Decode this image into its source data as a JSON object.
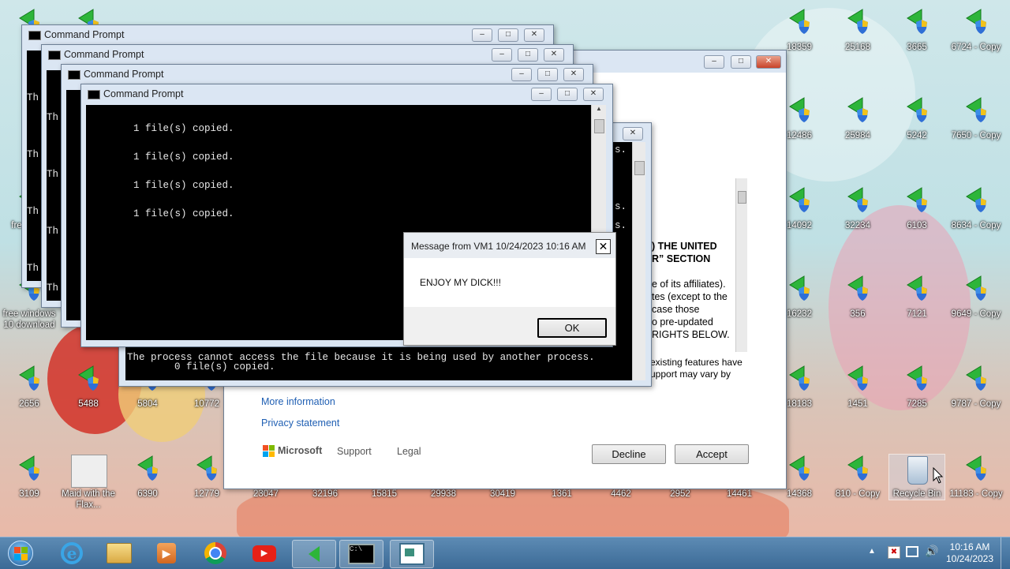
{
  "desktop_icons": [
    {
      "id": "r1c1",
      "label": "Co"
    },
    {
      "id": "r1c2",
      "label": ""
    },
    {
      "id": "r1c11",
      "label": "18359"
    },
    {
      "id": "r1c12",
      "label": "25168"
    },
    {
      "id": "r1c13",
      "label": "3665"
    },
    {
      "id": "r1c14",
      "label": "6724 - Copy"
    },
    {
      "id": "r2c11",
      "label": "12486"
    },
    {
      "id": "r2c12",
      "label": "25984"
    },
    {
      "id": "r2c13",
      "label": "5242"
    },
    {
      "id": "r2c14",
      "label": "7650 - Copy"
    },
    {
      "id": "r3c1",
      "label": "free 10 d"
    },
    {
      "id": "r3c11",
      "label": "14092"
    },
    {
      "id": "r3c12",
      "label": "32234"
    },
    {
      "id": "r3c13",
      "label": "6103"
    },
    {
      "id": "r3c14",
      "label": "8634 - Copy"
    },
    {
      "id": "r4c1",
      "label": "free windows 10 download"
    },
    {
      "id": "r4c11",
      "label": "16232"
    },
    {
      "id": "r4c12",
      "label": "356"
    },
    {
      "id": "r4c13",
      "label": "7121"
    },
    {
      "id": "r4c14",
      "label": "9649 - Copy"
    },
    {
      "id": "r5c1",
      "label": "2656"
    },
    {
      "id": "r5c2",
      "label": "5488"
    },
    {
      "id": "r5c3",
      "label": "5804"
    },
    {
      "id": "r5c4",
      "label": "10772"
    },
    {
      "id": "r5c11",
      "label": "18183"
    },
    {
      "id": "r5c12",
      "label": "1451"
    },
    {
      "id": "r5c13",
      "label": "7285"
    },
    {
      "id": "r5c14",
      "label": "9787 - Copy"
    },
    {
      "id": "r6c1",
      "label": "3109"
    },
    {
      "id": "r6c2",
      "label": "Maid with the Flax..."
    },
    {
      "id": "r6c3",
      "label": "6390"
    },
    {
      "id": "r6c4",
      "label": "12779"
    },
    {
      "id": "r6c5",
      "label": "23047"
    },
    {
      "id": "r6c6",
      "label": "32196"
    },
    {
      "id": "r6c7",
      "label": "15815"
    },
    {
      "id": "r6c8",
      "label": "29938"
    },
    {
      "id": "r6c9",
      "label": "30419"
    },
    {
      "id": "r6c10",
      "label": "1361"
    },
    {
      "id": "r6c11",
      "label": "4462"
    },
    {
      "id": "r6c12",
      "label": "2952"
    },
    {
      "id": "r6c13",
      "label": "14461"
    },
    {
      "id": "r6c14",
      "label": "14368"
    },
    {
      "id": "r6c15",
      "label": "810 - Copy"
    },
    {
      "id": "r6c16",
      "label": "Recycle Bin"
    },
    {
      "id": "r6c17",
      "label": "11183 - Copy"
    }
  ],
  "cmd_windows": [
    {
      "title": "Command Prompt",
      "partial_lines": [
        "Th",
        "Th",
        "Th",
        "Th"
      ]
    },
    {
      "title": "Command Prompt",
      "partial_lines": [
        "Th",
        "Th",
        "Th",
        "Th"
      ]
    },
    {
      "title": "Command Prompt"
    },
    {
      "title": "Command Prompt",
      "lines": [
        "        1 file(s) copied.",
        "        1 file(s) copied.",
        "        1 file(s) copied.",
        "        1 file(s) copied."
      ]
    }
  ],
  "back_console": {
    "fragments": [
      "s.",
      "s.",
      "s."
    ],
    "lines": [
      "The process cannot access the file because it is being used by another process.",
      "        0 file(s) copied."
    ]
  },
  "license": {
    "heading_lines": [
      ") THE UNITED",
      "R” SECTION"
    ],
    "body_lines": [
      "e of its affiliates).",
      "tes (except to the",
      " case those",
      "o pre-updated",
      "RIGHTS BELOW."
    ],
    "footer_lines": [
      "existing features have",
      "upport may vary by"
    ],
    "more_info": "More information",
    "privacy": "Privacy statement",
    "brand": "Microsoft",
    "support": "Support",
    "legal": "Legal",
    "decline": "Decline",
    "accept": "Accept"
  },
  "message_box": {
    "title": "Message from VM1 10/24/2023 10:16 AM",
    "text": "ENJOY MY DICK!!!",
    "ok": "OK"
  },
  "taskbar": {
    "time": "10:16 AM",
    "date": "10/24/2023"
  },
  "colors": {
    "accent": "#3b6a96",
    "msgbox_ok_border": "#000000"
  }
}
